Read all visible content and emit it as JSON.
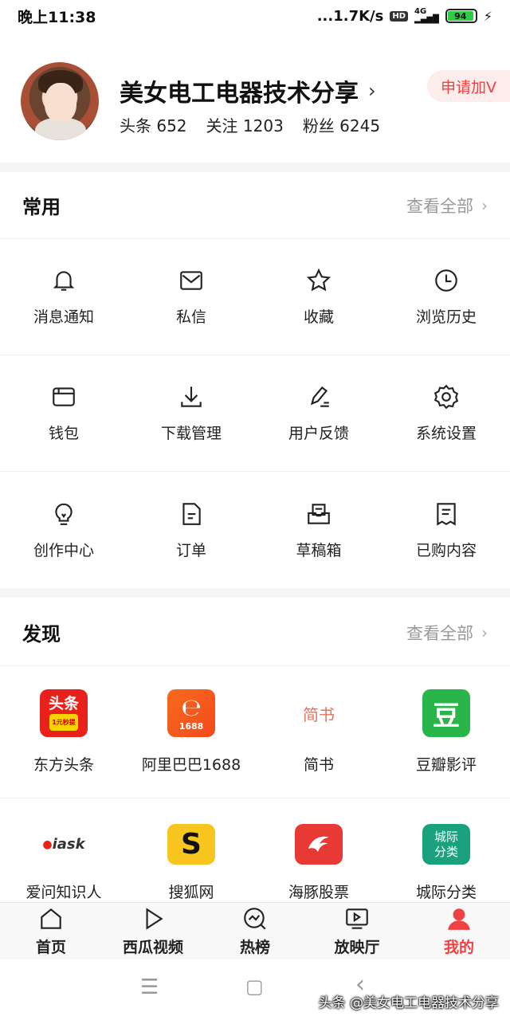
{
  "status_bar": {
    "time": "晚上11:38",
    "net_speed": "...1.7K/s",
    "hd": "HD",
    "signal": "4G",
    "battery": "94",
    "battery_level": 0.94
  },
  "profile": {
    "name": "美女电工电器技术分享",
    "stats": [
      {
        "label": "头条",
        "value": "652"
      },
      {
        "label": "关注",
        "value": "1203"
      },
      {
        "label": "粉丝",
        "value": "6245"
      }
    ],
    "apply_label": "申请加V"
  },
  "common": {
    "title": "常用",
    "view_all": "查看全部",
    "items": [
      {
        "label": "消息通知",
        "icon": "bell-icon"
      },
      {
        "label": "私信",
        "icon": "mail-icon"
      },
      {
        "label": "收藏",
        "icon": "star-icon"
      },
      {
        "label": "浏览历史",
        "icon": "clock-icon"
      },
      {
        "label": "钱包",
        "icon": "wallet-icon"
      },
      {
        "label": "下载管理",
        "icon": "download-icon"
      },
      {
        "label": "用户反馈",
        "icon": "pen-icon"
      },
      {
        "label": "系统设置",
        "icon": "gear-icon"
      },
      {
        "label": "创作中心",
        "icon": "bulb-icon"
      },
      {
        "label": "订单",
        "icon": "document-icon"
      },
      {
        "label": "草稿箱",
        "icon": "draft-box-icon"
      },
      {
        "label": "已购内容",
        "icon": "receipt-icon"
      }
    ]
  },
  "discover": {
    "title": "发现",
    "view_all": "查看全部",
    "apps": [
      {
        "label": "东方头条",
        "icon": "dongfang-toutiao-app-icon",
        "badge_text": "头条",
        "badge_sub": "1元秒提",
        "color": "#e8221b"
      },
      {
        "label": "阿里巴巴1688",
        "icon": "alibaba-1688-app-icon",
        "badge_text": "1688",
        "color": "#f4561e"
      },
      {
        "label": "简书",
        "icon": "jianshu-app-icon",
        "badge_text": "简书",
        "color": "#ea6f5a"
      },
      {
        "label": "豆瓣影评",
        "icon": "douban-app-icon",
        "badge_text": "豆",
        "color": "#2ab54b"
      },
      {
        "label": "爱问知识人",
        "icon": "iask-app-icon",
        "badge_text": "iask",
        "color": "#333333"
      },
      {
        "label": "搜狐网",
        "icon": "sohu-app-icon",
        "badge_text": "S",
        "color": "#f7c51e"
      },
      {
        "label": "海豚股票",
        "icon": "dolphin-stock-app-icon",
        "badge_text": "",
        "color": "#e83a35"
      },
      {
        "label": "城际分类",
        "icon": "chengji-app-icon",
        "badge_text": "城际\n分类",
        "color": "#1aa17e"
      }
    ]
  },
  "tabbar": {
    "tabs": [
      {
        "label": "首页",
        "icon": "home-icon"
      },
      {
        "label": "西瓜视频",
        "icon": "play-icon"
      },
      {
        "label": "热榜",
        "icon": "trending-icon"
      },
      {
        "label": "放映厅",
        "icon": "screen-icon"
      },
      {
        "label": "我的",
        "icon": "profile-icon"
      }
    ],
    "active_color": "#f04142"
  },
  "watermark": "头条 @美女电工电器技术分享"
}
